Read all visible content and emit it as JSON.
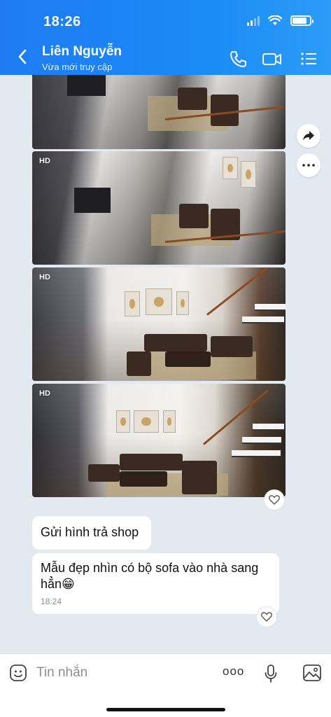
{
  "status_bar": {
    "time": "18:26"
  },
  "header": {
    "contact_name": "Liên Nguyễn",
    "contact_status": "Vừa mới truy cập"
  },
  "icons": {
    "back": "chevron-left-icon",
    "call": "phone-icon",
    "video": "video-camera-icon",
    "menu": "list-menu-icon",
    "share": "share-arrow-icon",
    "more": "more-dots-icon",
    "heart": "heart-icon",
    "emoji": "emoji-icon",
    "mic": "microphone-icon",
    "image": "image-icon"
  },
  "photos": [
    {
      "badge": ""
    },
    {
      "badge": "HD"
    },
    {
      "badge": "HD"
    },
    {
      "badge": "HD"
    }
  ],
  "messages": [
    {
      "text": "Gửi hình trả shop"
    },
    {
      "text": "Mẫu đẹp nhìn có bộ sofa vào nhà sang hẳn😁",
      "time": "18:24"
    }
  ],
  "composer": {
    "placeholder": "Tin nhắn",
    "more_label": "ooo"
  },
  "colors": {
    "header_blue": "#1f7bf2",
    "chat_background": "#e2e9f1",
    "bubble": "#ffffff"
  }
}
